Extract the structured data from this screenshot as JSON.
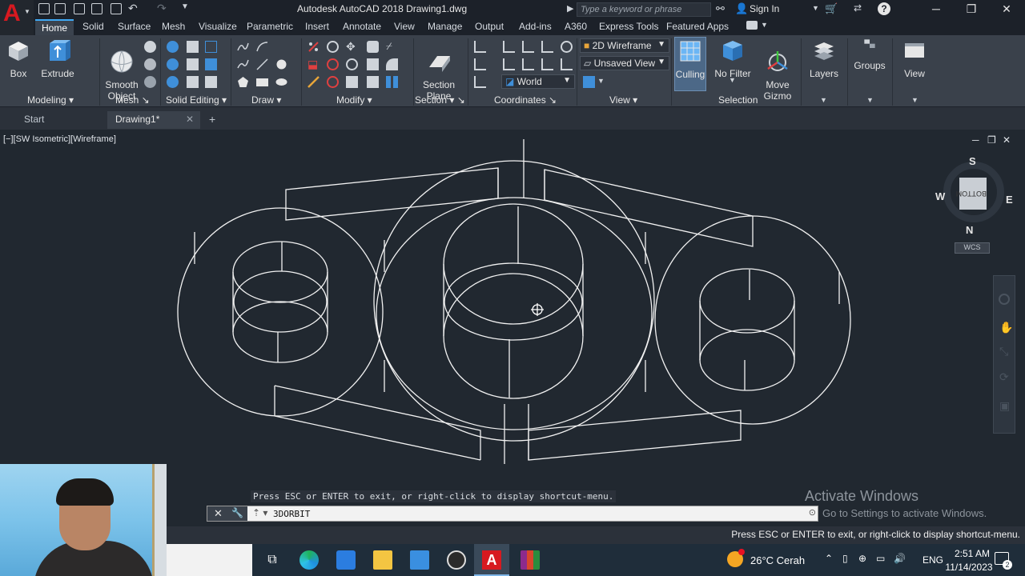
{
  "title_bar": {
    "app_title": "Autodesk AutoCAD 2018    Drawing1.dwg",
    "search_placeholder": "Type a keyword or phrase",
    "sign_in": "Sign In"
  },
  "ribbon_tabs": [
    "Home",
    "Solid",
    "Surface",
    "Mesh",
    "Visualize",
    "Parametric",
    "Insert",
    "Annotate",
    "View",
    "Manage",
    "Output",
    "Add-ins",
    "A360",
    "Express Tools",
    "Featured Apps"
  ],
  "ribbon": {
    "box": "Box",
    "extrude": "Extrude",
    "smooth_object": "Smooth\nObject",
    "section_plane": "Section\nPlane",
    "visual_style": "2D Wireframe",
    "view_state": "Unsaved View",
    "ucs": "World",
    "culling": "Culling",
    "no_filter": "No Filter",
    "move_gizmo": "Move\nGizmo",
    "layers": "Layers",
    "groups": "Groups",
    "view": "View",
    "panels": {
      "modeling": "Modeling",
      "mesh": "Mesh",
      "solid_editing": "Solid Editing",
      "draw": "Draw",
      "modify": "Modify",
      "section": "Section",
      "coordinates": "Coordinates",
      "view": "View",
      "selection": "Selection"
    }
  },
  "file_tabs": [
    "Start",
    "Drawing1*"
  ],
  "viewport": {
    "label": "[−][SW Isometric][Wireframe]",
    "viewcube": {
      "face": "BOTTOM",
      "north": "N",
      "south": "S",
      "east": "E",
      "west": "W",
      "wcs": "WCS"
    }
  },
  "command": {
    "hint": "Press ESC or ENTER to exit, or right-click to display shortcut-menu.",
    "input": "3DORBIT"
  },
  "watermark": {
    "title": "Activate Windows",
    "subtitle": "Go to Settings to activate Windows."
  },
  "status_text": "Press ESC or ENTER to exit, or right-click to display shortcut-menu.",
  "taskbar": {
    "weather": "26°C  Cerah",
    "language": "ENG",
    "time": "2:51 AM",
    "date": "11/14/2023",
    "notification_count": "2"
  }
}
